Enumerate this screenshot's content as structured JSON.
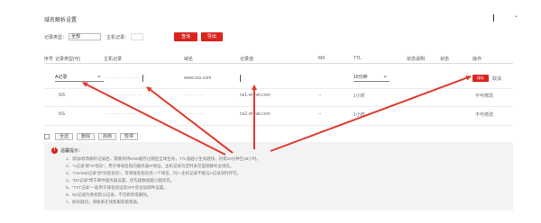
{
  "page": {
    "title": "域名解析设置"
  },
  "language": {
    "value": "",
    "chevron": "⌄"
  },
  "filters": {
    "type_label": "记录类型：",
    "type_value": "全部",
    "host_label": "主机记录：",
    "search_label": "查询",
    "export_label": "导出"
  },
  "table": {
    "headers": [
      "序号",
      "记录类型(可)",
      "主机记录",
      "域名",
      "记录值",
      "MX",
      "TTL",
      "状态说明",
      "状态",
      "操作"
    ],
    "rows": [
      {
        "index": "",
        "type": "A记录",
        "host": "",
        "domain": "www.xxx.com",
        "value": "",
        "mx": "",
        "ttl": "10分钟",
        "op_primary": "保存",
        "op_secondary": "取消"
      },
      {
        "index": "NS",
        "type": "",
        "host": "",
        "domain": "",
        "value": "ns1.xinnet.com",
        "mx": "--",
        "ttl": "1小时",
        "op_primary": "",
        "op_secondary": "不可修改"
      },
      {
        "index": "NS",
        "type": "",
        "host": "",
        "domain": "",
        "value": "ns2.xinnet.com",
        "mx": "--",
        "ttl": "1小时",
        "op_primary": "",
        "op_secondary": "不可修改"
      }
    ]
  },
  "bulk": {
    "select_all": "全选",
    "delete": "删除",
    "enable": "启用",
    "pause": "暂停"
  },
  "notice": {
    "title": "温馨提示：",
    "lines": [
      "1、添加/修改解析记录后，需要等待DNS缓存过期后全球生效，TTL值越小生效越快，约需10分钟至48小时。",
      "2、“A记录”即“IP指向”，用于将域名指向服务器IP地址，主机记录为空时表示直接解析主域名。",
      "3、“CNAME记录”即“别名指向”，可将域名指向另一个域名，同一主机记录不能与A记录同时存在。",
      "4、“MX记录”用于邮件服务器设置，优先级数值越小越优先。",
      "5、“TXT记录”一般用于域名验证及SPF反垃圾邮件设置。",
      "6、NS记录为系统默认记录，不可修改或删除。",
      "7、如有疑问，请联系在线客服获取帮助。"
    ]
  },
  "colors": {
    "accent": "#d9241f",
    "arrow": "#e03a2f"
  }
}
